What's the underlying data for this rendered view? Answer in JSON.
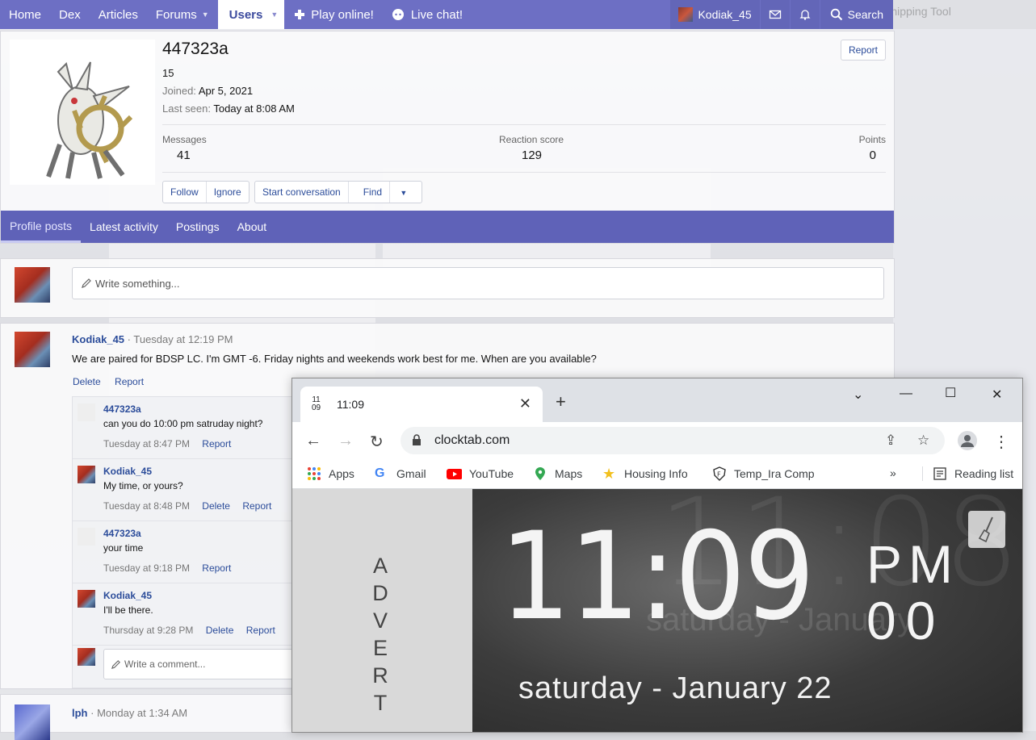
{
  "topnav": {
    "items": [
      "Home",
      "Dex",
      "Articles",
      "Forums",
      "Users",
      "Play online!",
      "Live chat!"
    ],
    "user": "Kodiak_45",
    "search": "Search"
  },
  "background": {
    "snipping_tool": "Snipping Tool"
  },
  "profile": {
    "username": "447323a",
    "id": "15",
    "joined_label": "Joined:",
    "joined_value": "Apr 5, 2021",
    "seen_label": "Last seen:",
    "seen_value": "Today at 8:08 AM",
    "report": "Report",
    "stats": {
      "messages_label": "Messages",
      "messages_value": "41",
      "reaction_label": "Reaction score",
      "reaction_value": "129",
      "points_label": "Points",
      "points_value": "0"
    },
    "buttons": [
      "Follow",
      "Ignore",
      "Start conversation",
      "Find"
    ],
    "tabs": [
      "Profile posts",
      "Latest activity",
      "Postings",
      "About"
    ]
  },
  "write": {
    "placeholder": "Write something..."
  },
  "post": {
    "author": "Kodiak_45",
    "time": "· Tuesday at 12:19 PM",
    "body": "We are paired for BDSP LC. I'm GMT -6. Friday nights and weekends work best for me. When are you available?",
    "actions": [
      "Delete",
      "Report"
    ],
    "comments": [
      {
        "author": "447323a",
        "text": "can you do 10:00 pm satruday night?",
        "time": "Tuesday at 8:47 PM",
        "links": [
          "Report"
        ]
      },
      {
        "author": "Kodiak_45",
        "text": "My time, or yours?",
        "time": "Tuesday at 8:48 PM",
        "links": [
          "Delete",
          "Report"
        ]
      },
      {
        "author": "447323a",
        "text": "your time",
        "time": "Tuesday at 9:18 PM",
        "links": [
          "Report"
        ]
      },
      {
        "author": "Kodiak_45",
        "text": "I'll be there.",
        "time": "Thursday at 9:28 PM",
        "links": [
          "Delete",
          "Report"
        ]
      }
    ],
    "comment_placeholder": "Write a comment..."
  },
  "next_post": {
    "author": "lph",
    "time": "· Monday at 1:34 AM"
  },
  "chrome": {
    "tab_icon_top": "11",
    "tab_icon_bottom": "09",
    "tab_title": "11:09",
    "url": "clocktab.com",
    "bookmarks": [
      "Apps",
      "Gmail",
      "YouTube",
      "Maps",
      "Housing Info",
      "Temp_Ira Comp"
    ],
    "more": "»",
    "reading_list": "Reading list"
  },
  "clocktab": {
    "advert": [
      "A",
      "D",
      "V",
      "E",
      "R",
      "T"
    ],
    "time": "11:09",
    "ampm": "PM",
    "seconds": "00",
    "date": "saturday - January 22",
    "ghost_time": "11:08",
    "ghost_date": "saturday - January"
  }
}
